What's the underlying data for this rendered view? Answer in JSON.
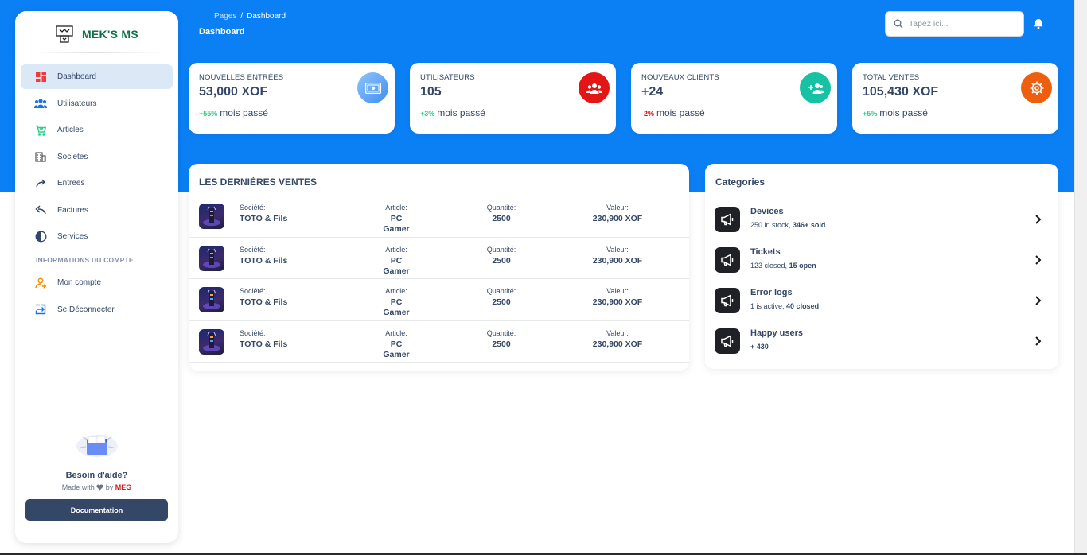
{
  "brand": {
    "name": "MEK'S MS"
  },
  "sidebar": {
    "items": [
      {
        "label": "Dashboard",
        "icon": "dashboard-icon"
      },
      {
        "label": "Utilisateurs",
        "icon": "users-icon"
      },
      {
        "label": "Articles",
        "icon": "cart-icon"
      },
      {
        "label": "Societes",
        "icon": "building-icon"
      },
      {
        "label": "Entrees",
        "icon": "share-arrow-icon"
      },
      {
        "label": "Factures",
        "icon": "reply-icon"
      },
      {
        "label": "Services",
        "icon": "services-icon"
      }
    ],
    "section_title": "INFORMATIONS DU COMPTE",
    "account_items": [
      {
        "label": "Mon compte",
        "icon": "user-account-icon"
      },
      {
        "label": "Se Déconnecter",
        "icon": "logout-icon"
      }
    ],
    "help": {
      "title": "Besoin d'aide?",
      "made_with": "Made with",
      "by": "by",
      "author": "MEG"
    },
    "doc_button": "Documentation"
  },
  "header": {
    "breadcrumb": {
      "root": "Pages",
      "separator": "/",
      "current": "Dashboard"
    },
    "title": "Dashboard",
    "search_placeholder": "Tapez ici..."
  },
  "stats": [
    {
      "label": "NOUVELLES ENTRÉES",
      "value": "53,000 XOF",
      "pct": "+55%",
      "foot": "mois passé",
      "color": "#5aa9f2"
    },
    {
      "label": "UTILISATEURS",
      "value": "105",
      "pct": "+3%",
      "foot": "mois passé",
      "color": "#e31515"
    },
    {
      "label": "NOUVEAUX CLIENTS",
      "value": "+24",
      "pct": "-2%",
      "foot": "mois passé",
      "color": "#17c1a4"
    },
    {
      "label": "TOTAL VENTES",
      "value": "105,430 XOF",
      "pct": "+5%",
      "foot": "mois passé",
      "color": "#ee5e0f"
    }
  ],
  "sales": {
    "title": "LES DERNIÈRES VENTES",
    "headers": {
      "company": "Société:",
      "article": "Article:",
      "quantity": "Quantité:",
      "value": "Valeur:"
    },
    "rows": [
      {
        "company": "TOTO & Fils",
        "article": "PC Gamer",
        "quantity": "2500",
        "value": "230,900 XOF"
      },
      {
        "company": "TOTO & Fils",
        "article": "PC Gamer",
        "quantity": "2500",
        "value": "230,900 XOF"
      },
      {
        "company": "TOTO & Fils",
        "article": "PC Gamer",
        "quantity": "2500",
        "value": "230,900 XOF"
      },
      {
        "company": "TOTO & Fils",
        "article": "PC Gamer",
        "quantity": "2500",
        "value": "230,900 XOF"
      }
    ]
  },
  "categories": {
    "title": "Categories",
    "items": [
      {
        "name": "Devices",
        "desc_a": "250 in stock,",
        "desc_b": "346+ sold"
      },
      {
        "name": "Tickets",
        "desc_a": "123 closed,",
        "desc_b": "15 open"
      },
      {
        "name": "Error logs",
        "desc_a": "1 is active,",
        "desc_b": "40 closed"
      },
      {
        "name": "Happy users",
        "desc_a": "",
        "desc_b": "+ 430"
      }
    ]
  }
}
